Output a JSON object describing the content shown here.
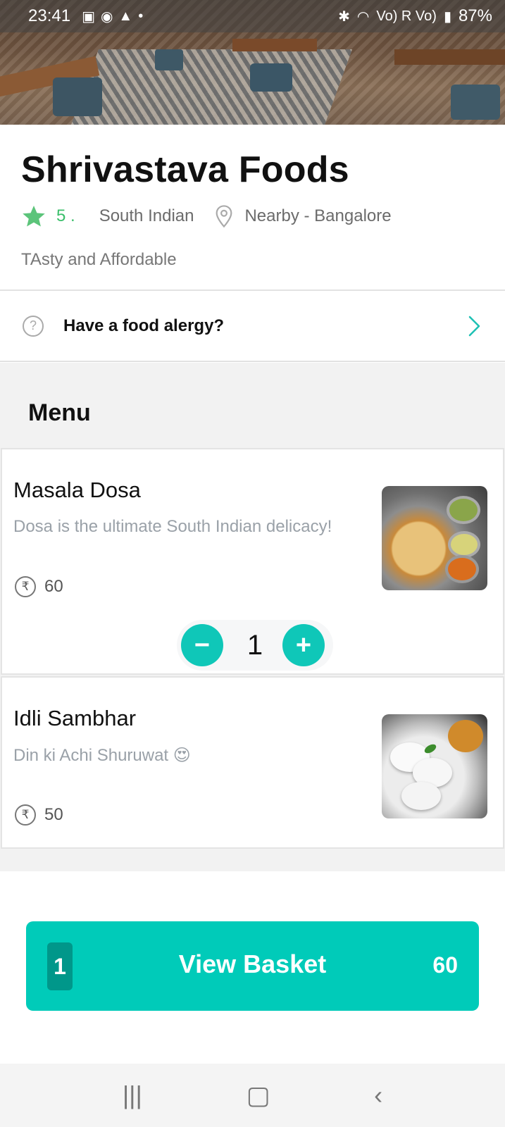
{
  "status_bar": {
    "time": "23:41",
    "signal_text": "Vo) R Vo)",
    "battery": "87%"
  },
  "restaurant": {
    "name": "Shrivastava Foods",
    "rating": "5 .",
    "cuisine": "South Indian",
    "location": "Nearby - Bangalore",
    "tagline": "TAsty and Affordable"
  },
  "allergy": {
    "label": "Have a food alergy?"
  },
  "menu": {
    "title": "Menu",
    "items": [
      {
        "name": "Masala Dosa",
        "description": "Dosa is the ultimate South Indian delicacy!",
        "price": "60",
        "quantity": "1"
      },
      {
        "name": "Idli Sambhar",
        "description": "Din ki Achi Shuruwat 😍",
        "price": "50"
      }
    ]
  },
  "basket": {
    "count": "1",
    "label": "View Basket",
    "total": "60"
  },
  "colors": {
    "accent": "#00cbb9",
    "rating_green": "#3bbf6b"
  },
  "icons": {
    "star": "star-icon",
    "location": "location-pin-icon",
    "help": "question-icon",
    "chevron": "chevron-right-icon",
    "currency": "rupee-icon"
  }
}
